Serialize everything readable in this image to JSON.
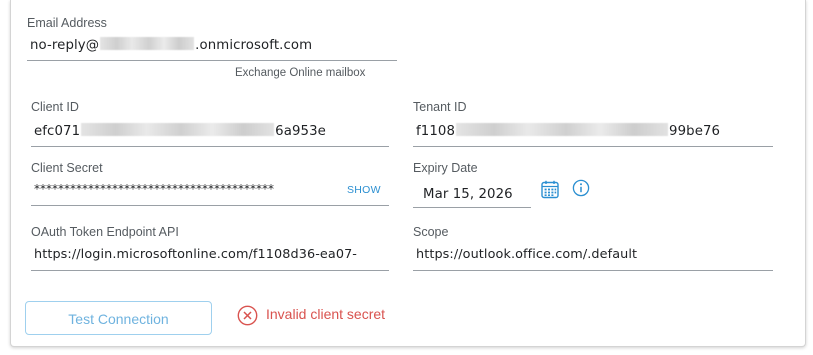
{
  "form": {
    "email": {
      "label": "Email Address",
      "value_prefix": "no-reply@",
      "value_suffix": ".onmicrosoft.com",
      "helper": "Exchange Online mailbox"
    },
    "client_id": {
      "label": "Client ID",
      "value_prefix": "efc071",
      "value_suffix": "6a953e"
    },
    "tenant_id": {
      "label": "Tenant ID",
      "value_prefix": "f1108",
      "value_suffix": "99be76"
    },
    "client_secret": {
      "label": "Client Secret",
      "value": "****************************************",
      "show_label": "SHOW"
    },
    "expiry_date": {
      "label": "Expiry Date",
      "value": "Mar 15, 2026"
    },
    "token_endpoint": {
      "label": "OAuth Token Endpoint API",
      "value": "https://login.microsoftonline.com/f1108d36-ea07-"
    },
    "scope": {
      "label": "Scope",
      "value": "https://outlook.office.com/.default"
    }
  },
  "actions": {
    "test_connection_label": "Test Connection"
  },
  "status": {
    "error_message": "Invalid client secret"
  },
  "icons": {
    "calendar": "calendar-icon",
    "info": "info-icon",
    "error": "error-circle-x-icon"
  },
  "colors": {
    "accent": "#2b8fd1",
    "button_border": "#9fd0ee",
    "button_text": "#6fb3df",
    "error": "#d9534f",
    "label": "#555b60",
    "underline": "#9aa0a6"
  }
}
